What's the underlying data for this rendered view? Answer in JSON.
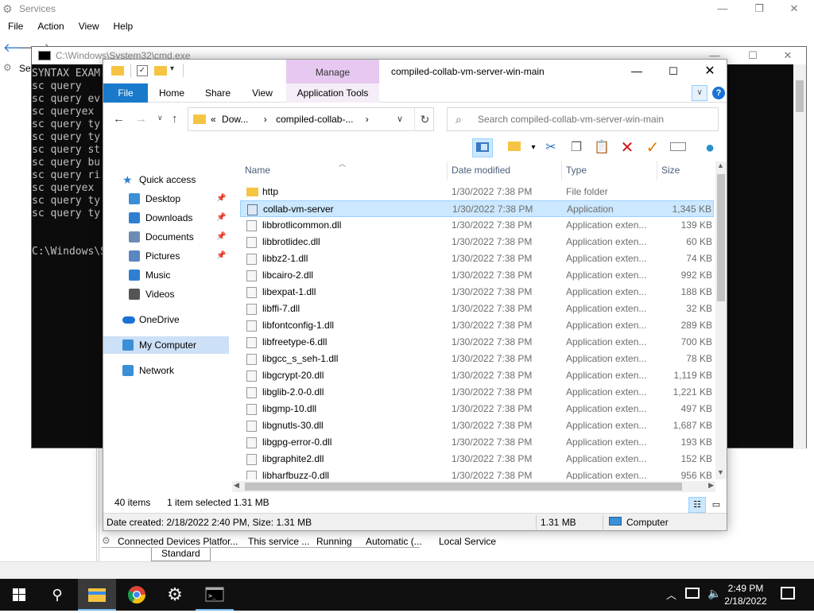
{
  "services": {
    "title": "Services",
    "menu": [
      "File",
      "Action",
      "View",
      "Help"
    ],
    "left_label": "Se",
    "row": {
      "name": "Connected Devices Platfor...",
      "description": "This service ...",
      "status": "Running",
      "startup": "Automatic (...",
      "logon": "Local Service"
    },
    "tab_standard": "Standard"
  },
  "cmd": {
    "title": "C:\\Windows\\System32\\cmd.exe",
    "lines": [
      "SYNTAX EXAM",
      "sc query",
      "sc query ev",
      "sc queryex",
      "sc query ty",
      "sc query ty",
      "sc query st",
      "sc query bu",
      "sc query ri",
      "sc queryex",
      "sc query ty",
      "sc query ty",
      "",
      "",
      "C:\\Windows\\S"
    ]
  },
  "explorer": {
    "title": "compiled-collab-vm-server-win-main",
    "manage_label": "Manage",
    "ribbon_tabs": {
      "file": "File",
      "home": "Home",
      "share": "Share",
      "view": "View",
      "app_tools": "Application Tools"
    },
    "address": {
      "prefix": "«",
      "crumb1": "Dow...",
      "sep": "›",
      "crumb2": "compiled-collab-...",
      "sep2": "›"
    },
    "search_placeholder": "Search compiled-collab-vm-server-win-main",
    "nav": [
      {
        "label": "Quick access",
        "icon": "star-icon",
        "pinned": false
      },
      {
        "label": "Desktop",
        "icon": "desktop-icon",
        "pinned": true
      },
      {
        "label": "Downloads",
        "icon": "downloads-icon",
        "pinned": true
      },
      {
        "label": "Documents",
        "icon": "documents-icon",
        "pinned": true
      },
      {
        "label": "Pictures",
        "icon": "pictures-icon",
        "pinned": true
      },
      {
        "label": "Music",
        "icon": "music-icon",
        "pinned": false
      },
      {
        "label": "Videos",
        "icon": "videos-icon",
        "pinned": false
      },
      {
        "label": "OneDrive",
        "icon": "onedrive-icon",
        "pinned": false
      },
      {
        "label": "My Computer",
        "icon": "computer-icon",
        "pinned": false,
        "selected": true
      },
      {
        "label": "Network",
        "icon": "network-icon",
        "pinned": false
      }
    ],
    "columns": {
      "name": "Name",
      "date": "Date modified",
      "type": "Type",
      "size": "Size"
    },
    "files": [
      {
        "name": "http",
        "date": "1/30/2022 7:38 PM",
        "type": "File folder",
        "size": "",
        "kind": "folder"
      },
      {
        "name": "collab-vm-server",
        "date": "1/30/2022 7:38 PM",
        "type": "Application",
        "size": "1,345 KB",
        "kind": "app",
        "selected": true
      },
      {
        "name": "libbrotlicommon.dll",
        "date": "1/30/2022 7:38 PM",
        "type": "Application exten...",
        "size": "139 KB",
        "kind": "dll"
      },
      {
        "name": "libbrotlidec.dll",
        "date": "1/30/2022 7:38 PM",
        "type": "Application exten...",
        "size": "60 KB",
        "kind": "dll"
      },
      {
        "name": "libbz2-1.dll",
        "date": "1/30/2022 7:38 PM",
        "type": "Application exten...",
        "size": "74 KB",
        "kind": "dll"
      },
      {
        "name": "libcairo-2.dll",
        "date": "1/30/2022 7:38 PM",
        "type": "Application exten...",
        "size": "992 KB",
        "kind": "dll"
      },
      {
        "name": "libexpat-1.dll",
        "date": "1/30/2022 7:38 PM",
        "type": "Application exten...",
        "size": "188 KB",
        "kind": "dll"
      },
      {
        "name": "libffi-7.dll",
        "date": "1/30/2022 7:38 PM",
        "type": "Application exten...",
        "size": "32 KB",
        "kind": "dll"
      },
      {
        "name": "libfontconfig-1.dll",
        "date": "1/30/2022 7:38 PM",
        "type": "Application exten...",
        "size": "289 KB",
        "kind": "dll"
      },
      {
        "name": "libfreetype-6.dll",
        "date": "1/30/2022 7:38 PM",
        "type": "Application exten...",
        "size": "700 KB",
        "kind": "dll"
      },
      {
        "name": "libgcc_s_seh-1.dll",
        "date": "1/30/2022 7:38 PM",
        "type": "Application exten...",
        "size": "78 KB",
        "kind": "dll"
      },
      {
        "name": "libgcrypt-20.dll",
        "date": "1/30/2022 7:38 PM",
        "type": "Application exten...",
        "size": "1,119 KB",
        "kind": "dll"
      },
      {
        "name": "libglib-2.0-0.dll",
        "date": "1/30/2022 7:38 PM",
        "type": "Application exten...",
        "size": "1,221 KB",
        "kind": "dll"
      },
      {
        "name": "libgmp-10.dll",
        "date": "1/30/2022 7:38 PM",
        "type": "Application exten...",
        "size": "497 KB",
        "kind": "dll"
      },
      {
        "name": "libgnutls-30.dll",
        "date": "1/30/2022 7:38 PM",
        "type": "Application exten...",
        "size": "1,687 KB",
        "kind": "dll"
      },
      {
        "name": "libgpg-error-0.dll",
        "date": "1/30/2022 7:38 PM",
        "type": "Application exten...",
        "size": "193 KB",
        "kind": "dll"
      },
      {
        "name": "libgraphite2.dll",
        "date": "1/30/2022 7:38 PM",
        "type": "Application exten...",
        "size": "152 KB",
        "kind": "dll"
      },
      {
        "name": "libharfbuzz-0.dll",
        "date": "1/30/2022 7:38 PM",
        "type": "Application exten...",
        "size": "956 KB",
        "kind": "dll"
      }
    ],
    "status": {
      "items": "40 items",
      "selected": "1 item selected",
      "sel_size": "1.31 MB"
    },
    "details_bar": {
      "info": "Date created: 2/18/2022 2:40 PM, Size: 1.31 MB",
      "size": "1.31 MB",
      "location": "Computer"
    }
  },
  "taskbar": {
    "time": "2:49 PM",
    "date": "2/18/2022"
  },
  "colors": {
    "accent": "#1979ca",
    "selection": "#cce8ff",
    "manage_tab": "#e6c8f0",
    "taskbar": "#101010"
  }
}
